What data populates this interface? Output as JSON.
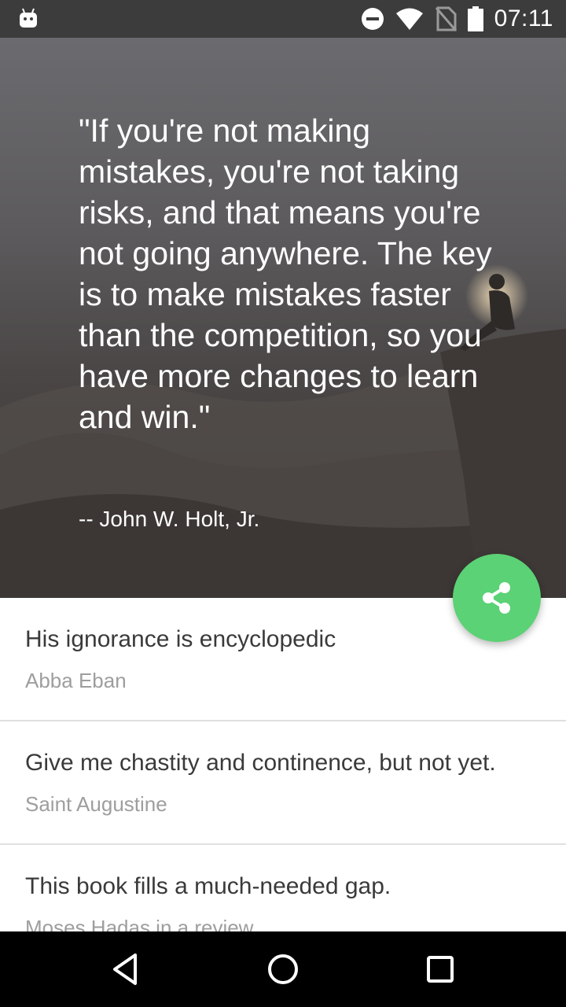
{
  "status_bar": {
    "time": "07:11",
    "icons": [
      "android-icon",
      "do-not-disturb-icon",
      "wifi-icon",
      "no-sim-icon",
      "battery-icon"
    ]
  },
  "hero": {
    "quote": "\"If you're not making mistakes, you're not taking risks, and that means you're not going anywhere. The key is to make mistakes faster than the competition, so you have more changes to learn and win.\"",
    "author": "-- John W. Holt, Jr."
  },
  "fab": {
    "icon": "share-icon",
    "color": "#5bd275"
  },
  "quotes": [
    {
      "text": "His ignorance is encyclopedic",
      "author": "Abba Eban"
    },
    {
      "text": "Give me chastity and continence, but not yet.",
      "author": "Saint Augustine"
    },
    {
      "text": "This book fills a much-needed gap.",
      "author": "Moses Hadas in a review"
    }
  ],
  "nav_bar": {
    "buttons": [
      "back-icon",
      "home-icon",
      "recents-icon"
    ]
  }
}
